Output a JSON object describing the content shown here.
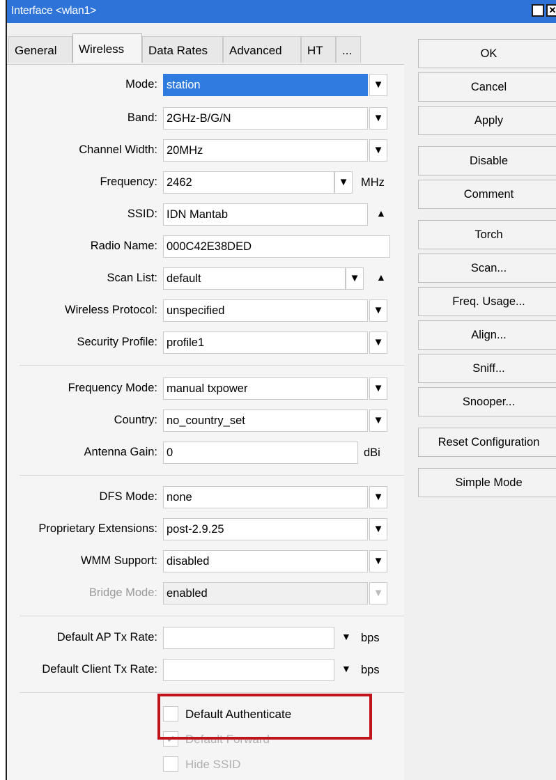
{
  "window": {
    "title": "Interface <wlan1>"
  },
  "tabs": [
    "General",
    "Wireless",
    "Data Rates",
    "Advanced",
    "HT",
    "..."
  ],
  "form": {
    "mode": {
      "label": "Mode:",
      "value": "station"
    },
    "band": {
      "label": "Band:",
      "value": "2GHz-B/G/N"
    },
    "channel_width": {
      "label": "Channel Width:",
      "value": "20MHz"
    },
    "frequency": {
      "label": "Frequency:",
      "value": "2462",
      "unit": "MHz"
    },
    "ssid": {
      "label": "SSID:",
      "value": "IDN Mantab"
    },
    "radio_name": {
      "label": "Radio Name:",
      "value": "000C42E38DED"
    },
    "scan_list": {
      "label": "Scan List:",
      "value": "default"
    },
    "wireless_protocol": {
      "label": "Wireless Protocol:",
      "value": "unspecified"
    },
    "security_profile": {
      "label": "Security Profile:",
      "value": "profile1"
    },
    "frequency_mode": {
      "label": "Frequency Mode:",
      "value": "manual txpower"
    },
    "country": {
      "label": "Country:",
      "value": "no_country_set"
    },
    "antenna_gain": {
      "label": "Antenna Gain:",
      "value": "0",
      "unit": "dBi"
    },
    "dfs_mode": {
      "label": "DFS Mode:",
      "value": "none"
    },
    "proprietary_extensions": {
      "label": "Proprietary Extensions:",
      "value": "post-2.9.25"
    },
    "wmm_support": {
      "label": "WMM Support:",
      "value": "disabled"
    },
    "bridge_mode": {
      "label": "Bridge Mode:",
      "value": "enabled"
    },
    "default_ap_tx_rate": {
      "label": "Default AP Tx Rate:",
      "value": "",
      "unit": "bps"
    },
    "default_client_tx_rate": {
      "label": "Default Client Tx Rate:",
      "value": "",
      "unit": "bps"
    }
  },
  "checkboxes": {
    "default_authenticate": {
      "label": "Default Authenticate",
      "checked": false
    },
    "default_forward": {
      "label": "Default Forward",
      "checked": true
    },
    "hide_ssid": {
      "label": "Hide SSID",
      "checked": false
    }
  },
  "buttons": [
    "OK",
    "Cancel",
    "Apply",
    "Disable",
    "Comment",
    "Torch",
    "Scan...",
    "Freq. Usage...",
    "Align...",
    "Sniff...",
    "Snooper...",
    "Reset Configuration",
    "Simple Mode"
  ],
  "icons": {
    "dropdown": "▼",
    "collapse": "▲",
    "restore": "☐",
    "close": "✕"
  },
  "colors": {
    "title_bar": "#2d73d8",
    "selection": "#2f7be0",
    "highlight_box": "#c0141c"
  }
}
